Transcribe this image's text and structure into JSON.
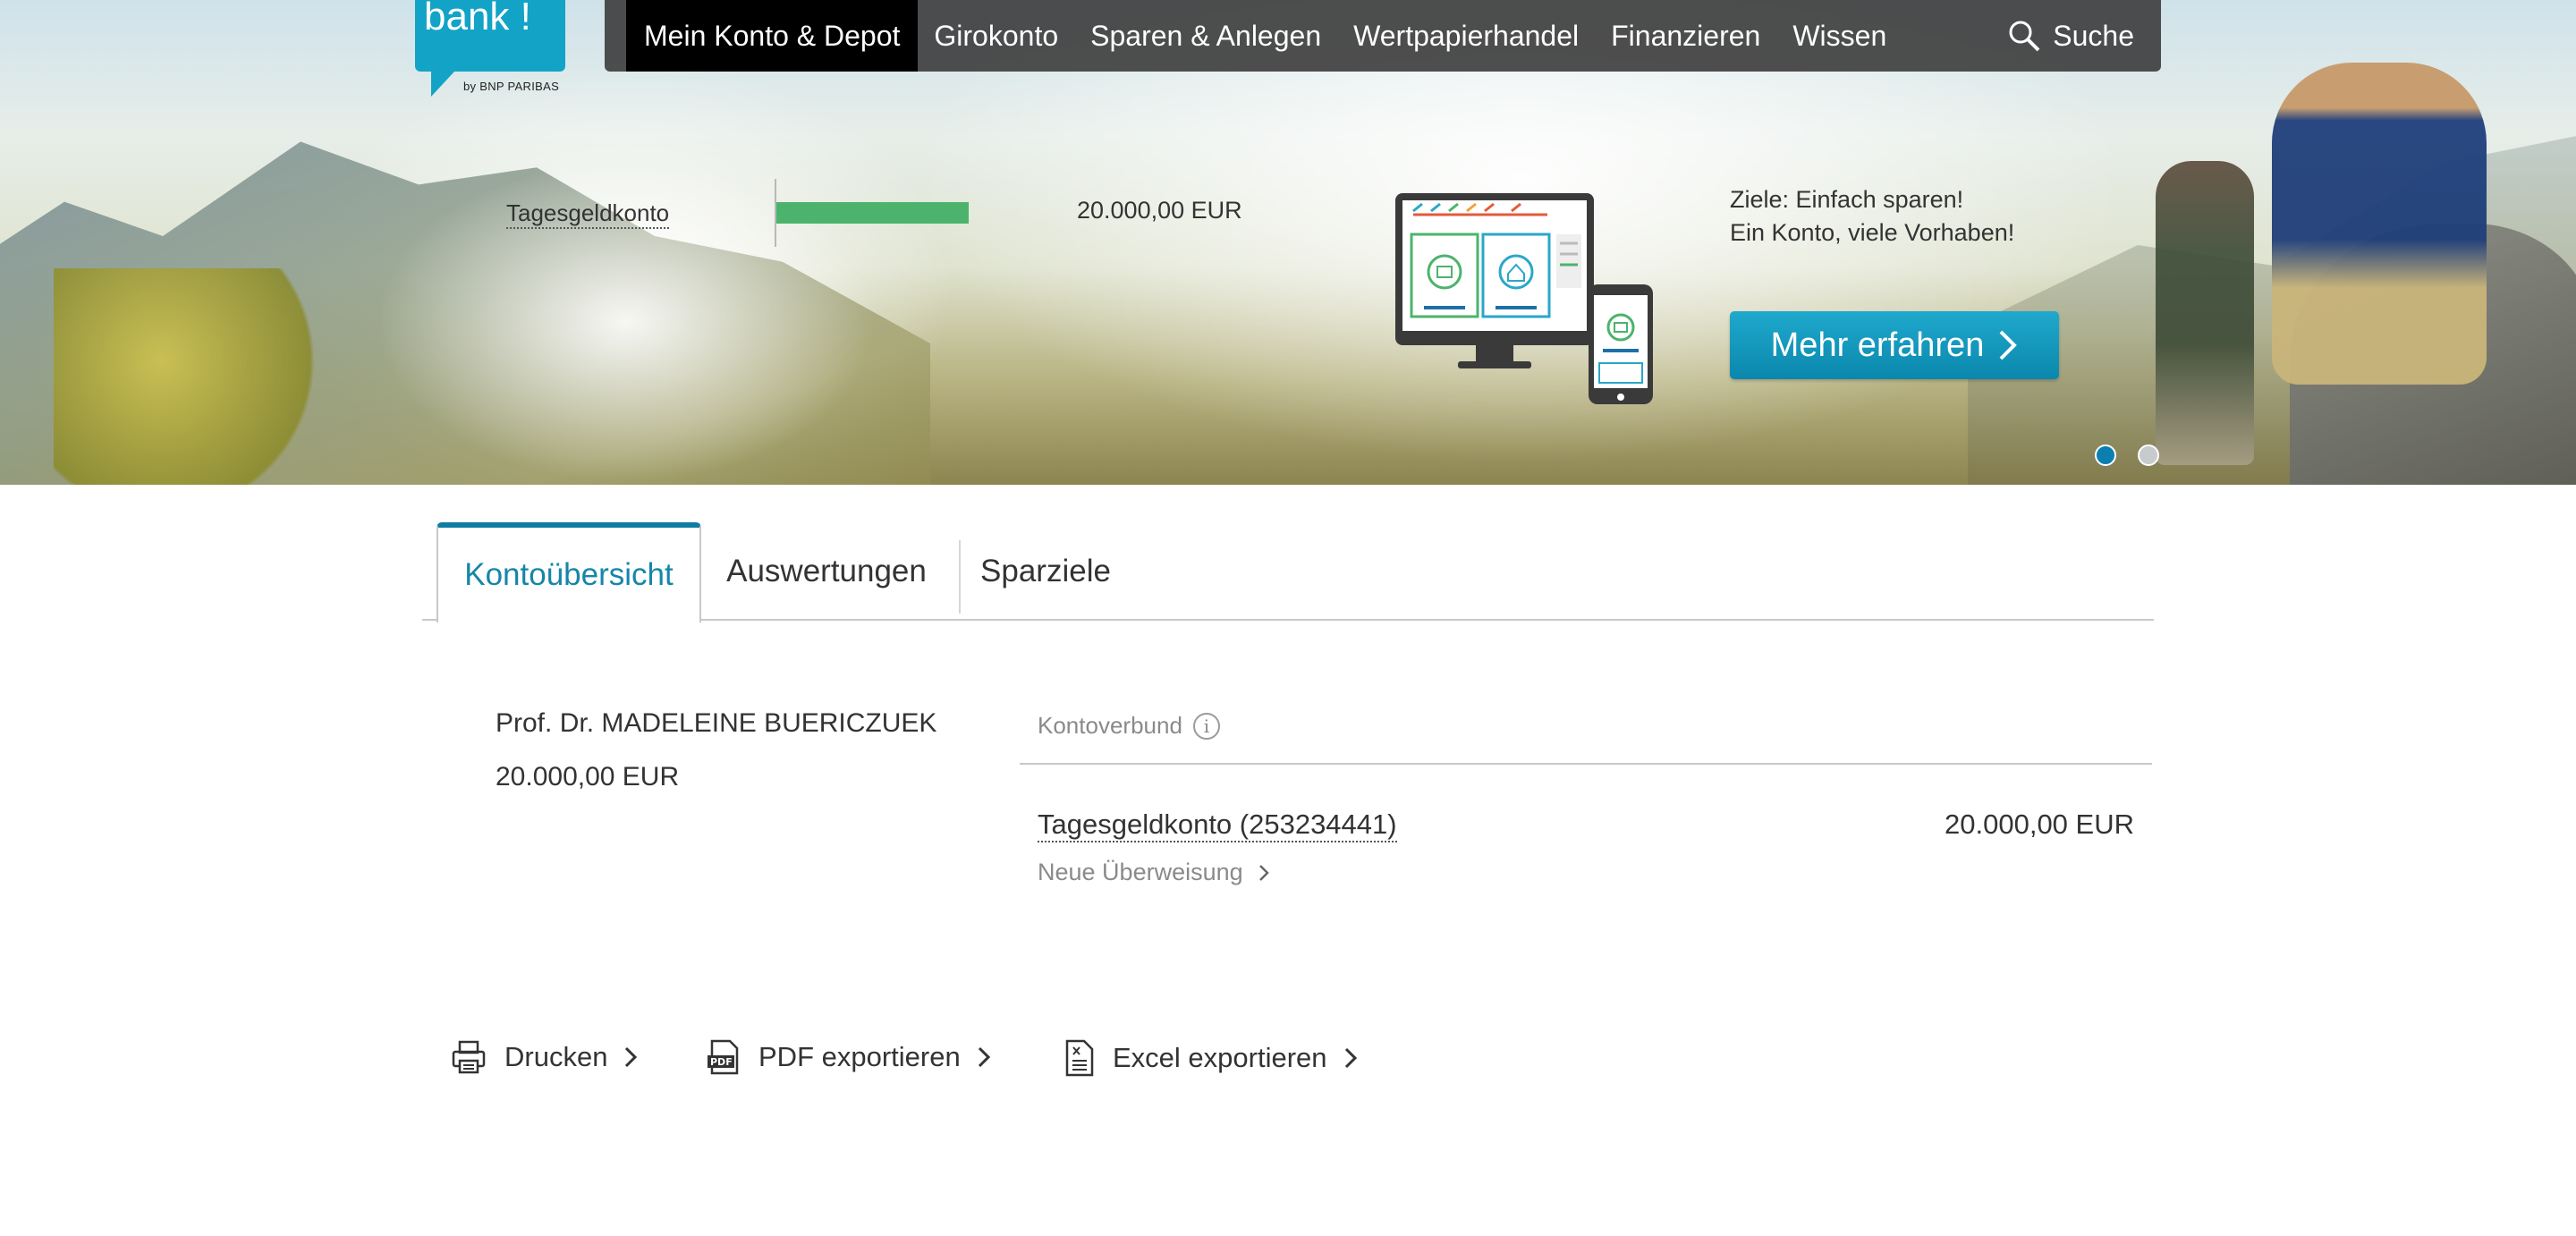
{
  "brand": {
    "logo_text": "bank !",
    "logo_subtitle": "by BNP PARIBAS",
    "primary_color": "#13a3c6"
  },
  "nav": {
    "items": [
      {
        "label": "Mein Konto & Depot",
        "active": true
      },
      {
        "label": "Girokonto"
      },
      {
        "label": "Sparen & Anlegen"
      },
      {
        "label": "Wertpapierhandel"
      },
      {
        "label": "Finanzieren"
      },
      {
        "label": "Wissen"
      }
    ],
    "search_label": "Suche"
  },
  "hero": {
    "account_label": "Tagesgeldkonto",
    "amount": "20.000,00 EUR",
    "bar_color": "#4cb36c",
    "promo_line1": "Ziele: Einfach sparen!",
    "promo_line2": "Ein Konto, viele Vorhaben!",
    "promo_button": "Mehr erfahren",
    "slides": 2,
    "active_slide": 1
  },
  "tabs": [
    {
      "label": "Kontoübersicht",
      "active": true
    },
    {
      "label": "Auswertungen"
    },
    {
      "label": "Sparziele"
    }
  ],
  "overview": {
    "owner_name": "Prof. Dr. MADELEINE BUERICZUEK",
    "owner_total": "20.000,00 EUR",
    "group_label": "Kontoverbund",
    "accounts": [
      {
        "name": "Tagesgeldkonto (253234441)",
        "amount": "20.000,00 EUR",
        "action": "Neue Überweisung"
      }
    ]
  },
  "actions": [
    {
      "label": "Drucken",
      "icon": "printer-icon"
    },
    {
      "label": "PDF exportieren",
      "icon": "pdf-icon"
    },
    {
      "label": "Excel exportieren",
      "icon": "excel-icon"
    }
  ]
}
